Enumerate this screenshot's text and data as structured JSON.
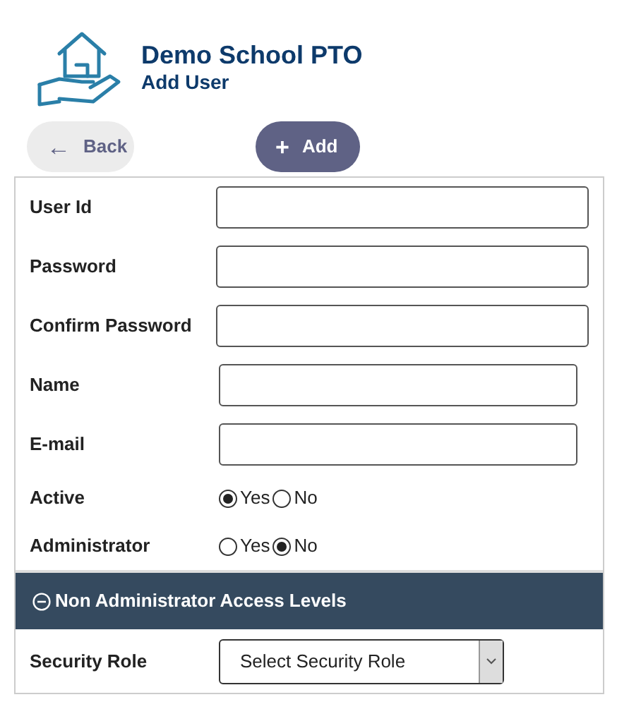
{
  "header": {
    "title": "Demo School PTO",
    "subtitle": "Add User"
  },
  "buttons": [
    {
      "kind": "back",
      "label": "Back",
      "icon": "←"
    },
    {
      "kind": "add",
      "label": "Add",
      "icon": "+"
    }
  ],
  "fields": [
    {
      "kind": "text",
      "label": "User Id"
    },
    {
      "kind": "text",
      "label": "Password"
    },
    {
      "kind": "text",
      "label": "Confirm Password"
    },
    {
      "kind": "text",
      "label": "Name"
    },
    {
      "kind": "text",
      "label": "E-mail"
    },
    {
      "kind": "radio",
      "label": "Active",
      "options": [
        {
          "label": "Yes",
          "selected": true
        },
        {
          "label": "No",
          "selected": false
        }
      ]
    },
    {
      "kind": "radio",
      "label": "Administrator",
      "options": [
        {
          "label": "Yes",
          "selected": false
        },
        {
          "label": "No",
          "selected": true
        }
      ]
    }
  ],
  "section": {
    "title": "Non Administrator Access Levels",
    "expanded": true,
    "fields": [
      {
        "kind": "select",
        "label": "Security Role",
        "value": "Select Security Role"
      }
    ]
  }
}
